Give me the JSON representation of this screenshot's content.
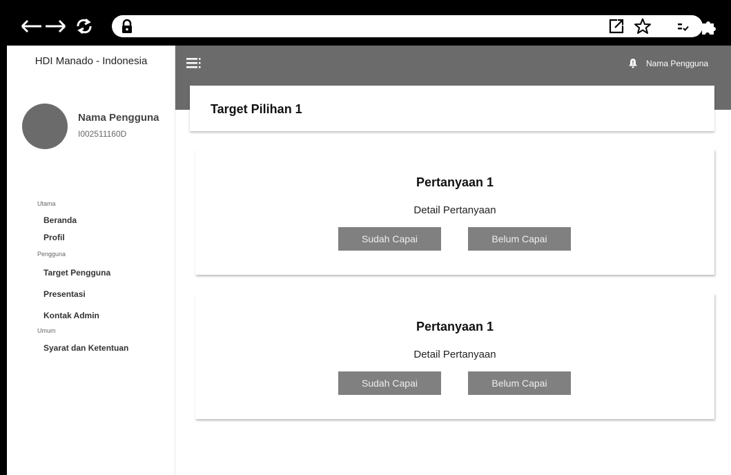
{
  "sidebar": {
    "brand": "HDI Manado - Indonesia",
    "user_name": "Nama Pengguna",
    "user_id": "I002511160D",
    "sections": {
      "utama": "Utama",
      "pengguna": "Pengguna",
      "umum": "Umum"
    },
    "items": {
      "beranda": "Beranda",
      "profil": "Profil",
      "target": "Target Pengguna",
      "presentasi": "Presentasi",
      "kontak": "Kontak Admin",
      "syarat": "Syarat dan Ketentuan"
    }
  },
  "topbar": {
    "user_name": "Nama Pengguna"
  },
  "page": {
    "title": "Target Pilihan 1"
  },
  "questions": [
    {
      "title": "Pertanyaan 1",
      "detail": "Detail Pertanyaan",
      "yes_label": "Sudah Capai",
      "no_label": "Belum Capai"
    },
    {
      "title": "Pertanyaan 1",
      "detail": "Detail Pertanyaan",
      "yes_label": "Sudah Capai",
      "no_label": "Belum Capai"
    }
  ],
  "icons": {
    "back": "arrow-left-icon",
    "forward": "arrow-right-icon",
    "reload": "reload-icon",
    "lock": "lock-icon",
    "open_external": "open-external-icon",
    "bookmark": "star-icon",
    "reading_list": "reading-list-icon",
    "extensions": "puzzle-icon",
    "menu": "hamburger-menu-icon",
    "notifications": "bell-icon"
  },
  "colors": {
    "header": "#6b6b6b",
    "button": "#808080",
    "avatar": "#6b6b6b"
  }
}
